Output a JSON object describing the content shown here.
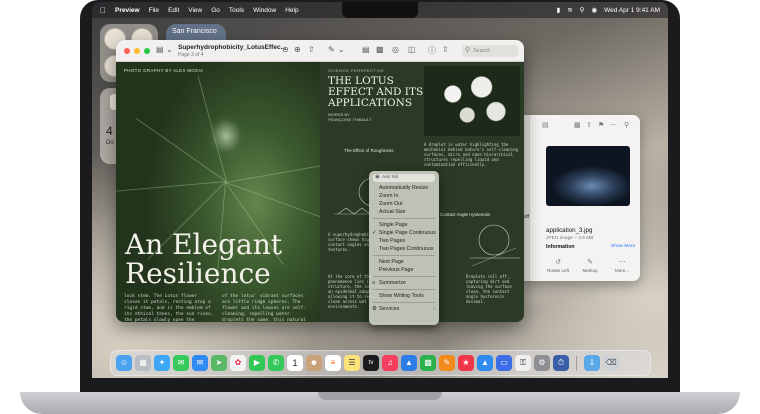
{
  "menubar": {
    "app_name": "Preview",
    "items": [
      "File",
      "Edit",
      "View",
      "Go",
      "Tools",
      "Window",
      "Help"
    ],
    "datetime": "Wed Apr 1  9:41 AM"
  },
  "widgets": {
    "weather_city": "San Francisco",
    "calendar_day": "4",
    "calendar_label": "Do"
  },
  "preview": {
    "doc_title": "Superhydrophobicity_LotusEffec...",
    "doc_subtitle": "Page 3 of 4",
    "search_placeholder": "Search",
    "left_page": {
      "photo_credit": "PHOTO GRAPHY BY ALEX MOSIA",
      "headline_line1": "An Elegant",
      "headline_line2": "Resilience",
      "body_col1": "lock stem. The Lotus flower closes it petals, resting atop a rigid stem, and is the emblem of its ethical tones, the sun rises, the petals slowly open the morning sun. Cycling its pattern to fall, and the drops softly head",
      "body_col2": "of the lotus' vibrant surfaces are little ridge spheres. The flower and its leaves are self-cleaning, repelling water droplets the same. this natural phenomenon are an question is in its own. Exhibit a complexity of protection are key engineering access the lotus effect"
    },
    "right_page": {
      "kicker": "SCIENCE PERSPECTIVE",
      "title_line1": "THE LOTUS",
      "title_line2": "EFFECT AND ITS",
      "title_line3": "APPLICATIONS",
      "byline_line1": "WORDS BY",
      "byline_line2": "FRANÇOISE THIBAULT",
      "diagram1_title": "The Effect of Roughness",
      "diagram2_title": "Contact Angle Hysteresis"
    }
  },
  "context_menu": {
    "search_placeholder": "Ask Siri",
    "items": [
      {
        "label": "Automatically Resize",
        "checked": false
      },
      {
        "label": "Zoom In",
        "checked": false
      },
      {
        "label": "Zoom Out",
        "checked": false
      },
      {
        "label": "Actual Size",
        "checked": false
      },
      {
        "label": "Single Page",
        "checked": false
      },
      {
        "label": "Single Page Continuous",
        "checked": true
      },
      {
        "label": "Two Pages",
        "checked": false
      },
      {
        "label": "Two Pages Continuous",
        "checked": false
      },
      {
        "label": "Next Page",
        "checked": false
      },
      {
        "label": "Previous Page",
        "checked": false
      },
      {
        "label": "Summarize",
        "checked": false
      },
      {
        "label": "Show Writing Tools",
        "checked": false
      },
      {
        "label": "Services",
        "checked": false
      }
    ]
  },
  "info_panel": {
    "file_tail": "h.pdf",
    "filename": "application_3.jpg",
    "meta": "JPEG image – 4.6 MB",
    "info_heading": "Information",
    "show_more": "Show More",
    "actions": [
      "Rotate Left",
      "Markup",
      "More..."
    ]
  },
  "dock": {
    "calendar_date": "1",
    "apps": [
      "Finder",
      "Launchpad",
      "Safari",
      "Messages",
      "Mail",
      "Maps",
      "Photos",
      "FaceTime",
      "Phone",
      "Calendar",
      "Contacts",
      "Reminders",
      "Notes",
      "TV",
      "Music",
      "Keynote",
      "Numbers",
      "Pages",
      "News",
      "App Store",
      "Mirroring",
      "Passwords",
      "System Settings",
      "Screen Time",
      "Downloads",
      "Trash"
    ],
    "tv_label": "tv"
  }
}
